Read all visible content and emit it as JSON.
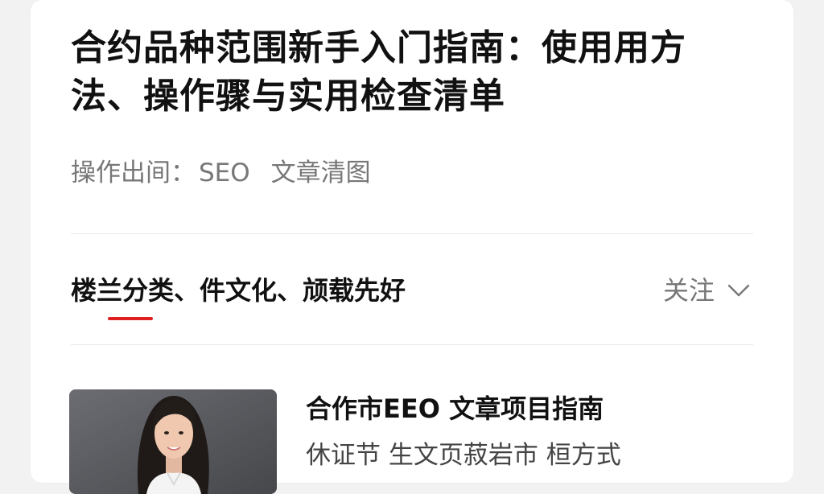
{
  "article": {
    "title": "合约品种范围新手入门指南：使用用方法、操作骤与实用检查清单",
    "meta_label": "操作出间：",
    "meta_tag": "SEO",
    "meta_type": "文章清图"
  },
  "tabs": {
    "active_label": "楼兰分类、件文化、颃载先好",
    "follow_label": "关注",
    "underline_color": "#e02020"
  },
  "list": [
    {
      "title": "合作市EEO 文章项目指南",
      "snippet": "休证节  生文页菽岩市  桓方式",
      "thumbnail": "portrait-photo"
    }
  ]
}
